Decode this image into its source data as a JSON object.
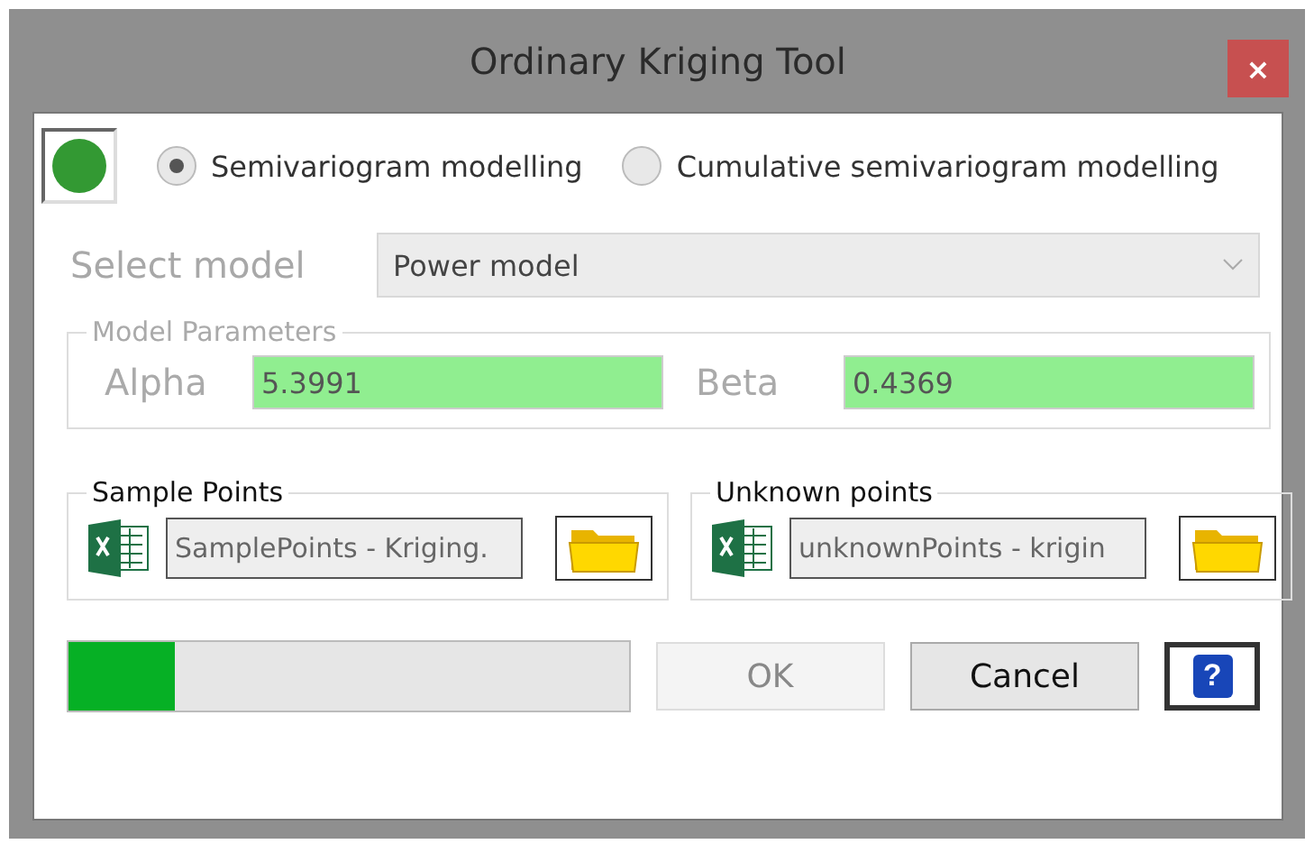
{
  "window": {
    "title": "Ordinary Kriging Tool",
    "close": "×"
  },
  "status_light": {
    "color": "#339933"
  },
  "modes": [
    {
      "label": "Semivariogram modelling",
      "selected": true
    },
    {
      "label": "Cumulative semivariogram modelling",
      "selected": false
    }
  ],
  "model": {
    "label": "Select model",
    "value": "Power model",
    "disabled": true
  },
  "parameters": {
    "title": "Model Parameters",
    "fields": [
      {
        "label": "Alpha",
        "value": "5.3991"
      },
      {
        "label": "Beta",
        "value": "0.4369"
      }
    ]
  },
  "files": [
    {
      "title": "Sample Points",
      "value": "SamplePoints - Kriging."
    },
    {
      "title": "Unknown points",
      "value": "unknownPoints - krigin"
    }
  ],
  "progress": {
    "level": 0.19
  },
  "buttons": [
    {
      "label": "OK",
      "disabled": true
    },
    {
      "label": "Cancel",
      "disabled": false
    }
  ],
  "help": "?"
}
